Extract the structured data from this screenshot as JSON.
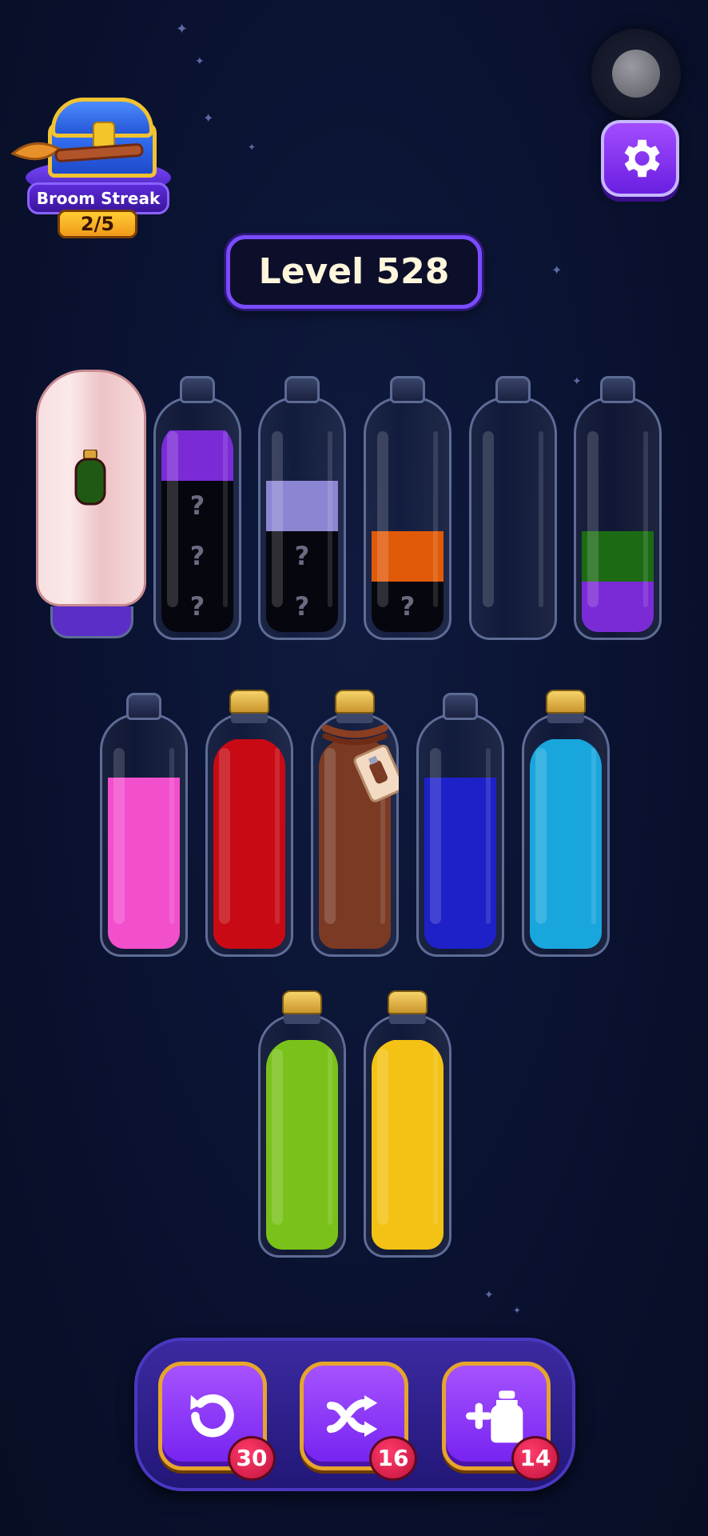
{
  "streak": {
    "label": "Broom Streak",
    "count": "2/5"
  },
  "level": {
    "label": "Level 528"
  },
  "icons": {
    "record": "record-button-icon",
    "settings": "gear-icon",
    "chest": "treasure-chest-icon",
    "broom": "broom-icon",
    "undo": "undo-icon",
    "shuffle": "shuffle-icon",
    "add_bottle": "add-bottle-icon"
  },
  "colors": {
    "purple": "#7b2bd6",
    "lavender": "#8c86d2",
    "orange": "#e05a0a",
    "dark_green": "#1c6b14",
    "pink": "#f24fcd",
    "red": "#c80a14",
    "brown": "#7a3a24",
    "blue": "#1e20c8",
    "sky": "#18a6dd",
    "lime": "#7ac21a",
    "yellow": "#f3c214"
  },
  "bottles": [
    {
      "id": 1,
      "state": "hidden",
      "cover": "ghost-cloth"
    },
    {
      "id": 2,
      "corked": false,
      "layers": [
        {
          "color": "purple",
          "known": true
        },
        {
          "color": "unknown",
          "known": false,
          "mark": "?"
        },
        {
          "color": "unknown",
          "known": false,
          "mark": "?"
        },
        {
          "color": "unknown",
          "known": false,
          "mark": "?"
        }
      ]
    },
    {
      "id": 3,
      "corked": false,
      "layers": [
        {
          "color": "lavender",
          "known": true
        },
        {
          "color": "unknown",
          "known": false,
          "mark": "?"
        },
        {
          "color": "unknown",
          "known": false,
          "mark": "?"
        }
      ]
    },
    {
      "id": 4,
      "corked": false,
      "layers": [
        {
          "color": "orange",
          "known": true
        },
        {
          "color": "unknown",
          "known": false,
          "mark": "?"
        }
      ]
    },
    {
      "id": 5,
      "corked": false,
      "layers": []
    },
    {
      "id": 6,
      "corked": false,
      "layers": [
        {
          "color": "dark_green",
          "known": true
        },
        {
          "color": "purple",
          "known": true
        }
      ]
    },
    {
      "id": 7,
      "corked": false,
      "layers": [
        {
          "color": "pink",
          "known": true
        }
      ]
    },
    {
      "id": 8,
      "corked": true,
      "layers": [
        {
          "color": "red",
          "known": true
        }
      ]
    },
    {
      "id": 9,
      "corked": true,
      "tied": true,
      "layers": [
        {
          "color": "brown",
          "known": true
        }
      ]
    },
    {
      "id": 10,
      "corked": false,
      "layers": [
        {
          "color": "blue",
          "known": true
        }
      ]
    },
    {
      "id": 11,
      "corked": true,
      "layers": [
        {
          "color": "sky",
          "known": true
        }
      ]
    },
    {
      "id": 12,
      "corked": true,
      "layers": [
        {
          "color": "lime",
          "known": true
        }
      ]
    },
    {
      "id": 13,
      "corked": true,
      "layers": [
        {
          "color": "yellow",
          "known": true
        }
      ]
    }
  ],
  "tools": [
    {
      "name": "undo",
      "count": "30"
    },
    {
      "name": "shuffle",
      "count": "16"
    },
    {
      "name": "add_bottle",
      "count": "14"
    }
  ]
}
